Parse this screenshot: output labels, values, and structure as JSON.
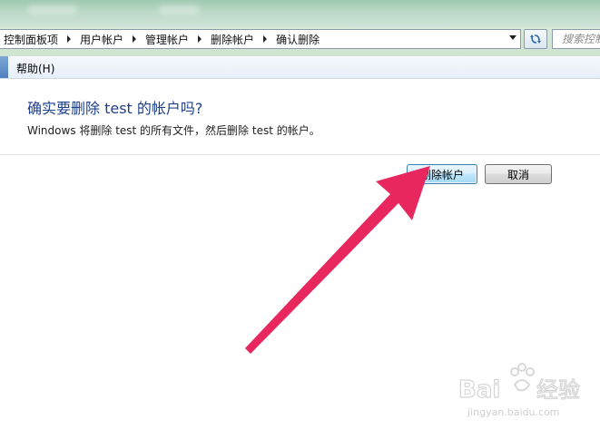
{
  "address_bar": {
    "breadcrumbs": [
      "控制面板项",
      "用户帐户",
      "管理帐户",
      "删除帐户",
      "确认删除"
    ],
    "search_placeholder": "搜索控制"
  },
  "menu": {
    "help_label": "帮助(H)"
  },
  "dialog": {
    "title": "确实要删除 test 的帐户吗?",
    "description": "Windows 将删除 test 的所有文件，然后删除 test 的帐户。",
    "delete_button": "删除帐户",
    "cancel_button": "取消"
  },
  "annotation": {
    "arrow_color": "#e8275f"
  },
  "watermark": {
    "brand": "Baidu 经验",
    "url": "jingyan.baidu.com"
  },
  "colors": {
    "title_blue": "#1e3f8b",
    "primary_button_border": "#3c7fb1"
  }
}
